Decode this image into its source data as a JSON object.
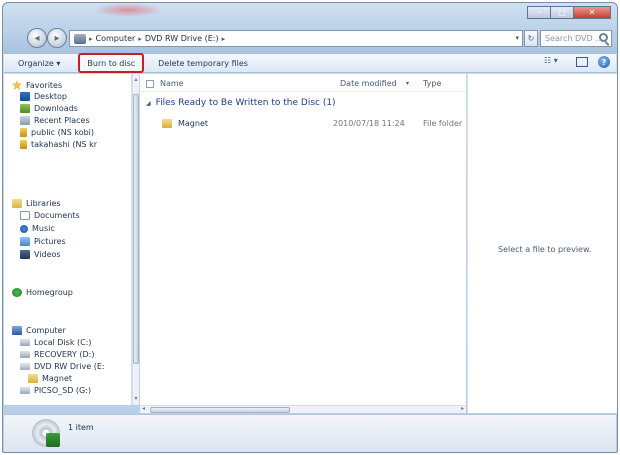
{
  "window": {
    "minimize": "–",
    "maximize": "□",
    "close": "✕"
  },
  "address": {
    "path": [
      "Computer",
      "DVD RW Drive (E:)"
    ],
    "separator": "▸"
  },
  "search": {
    "placeholder": "Search DVD ..."
  },
  "toolbar": {
    "organize": "Organize ▾",
    "burn": "Burn to disc",
    "delete_temp": "Delete temporary files"
  },
  "nav": {
    "favorites_label": "Favorites",
    "favorites": [
      "Desktop",
      "Downloads",
      "Recent Places",
      "public (NS kobi)",
      "takahashi (NS kr"
    ],
    "libraries_label": "Libraries",
    "libraries": [
      "Documents",
      "Music",
      "Pictures",
      "Videos"
    ],
    "homegroup": "Homegroup",
    "computer_label": "Computer",
    "drives": [
      "Local Disk (C:)",
      "RECOVERY (D:)",
      "DVD RW Drive (E:",
      "Magnet",
      "PICSO_SD (G:)"
    ]
  },
  "content": {
    "columns": {
      "name": "Name",
      "date": "Date modified",
      "type": "Type"
    },
    "group": {
      "label": "Files Ready to Be Written to the Disc (1)"
    },
    "files": [
      {
        "name": "Magnet",
        "date": "2010/07/18 11:24",
        "type": "File folder"
      }
    ]
  },
  "preview": {
    "message": "Select a file to preview."
  },
  "details": {
    "count": "1 item"
  },
  "colors": {
    "accent": "#cc1d22",
    "frame": "#b7cee6"
  }
}
